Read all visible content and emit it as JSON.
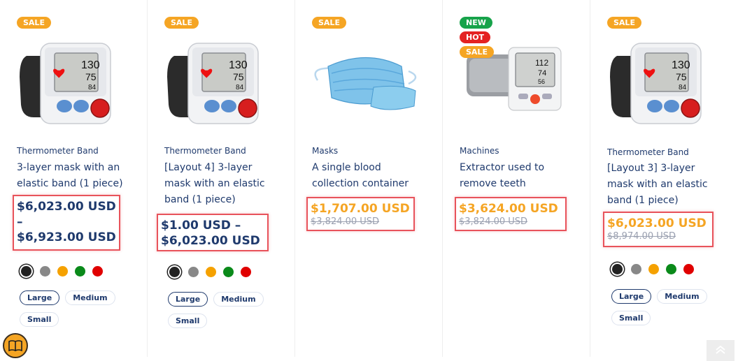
{
  "products": [
    {
      "badges": [
        "SALE"
      ],
      "category": "Thermometer Band",
      "title": "3-layer mask with an elastic band (1 piece)",
      "price_lines": [
        "$6,023.00 USD",
        "–",
        "$6,923.00 USD"
      ],
      "sizes": [
        "Large",
        "Medium",
        "Small"
      ],
      "image": "blood-pressure-monitor"
    },
    {
      "badges": [
        "SALE"
      ],
      "category": "Thermometer Band",
      "title": "[Layout 4] 3-layer mask with an elastic band (1 piece)",
      "price_lines": [
        "$1.00 USD –",
        "$6,023.00 USD"
      ],
      "sizes": [
        "Large",
        "Medium",
        "Small"
      ],
      "image": "blood-pressure-monitor"
    },
    {
      "badges": [
        "SALE"
      ],
      "category": "Masks",
      "title": "A single blood collection container",
      "price": "$1,707.00 USD",
      "old_price": "$3,824.00 USD",
      "image": "surgical-mask"
    },
    {
      "badges": [
        "NEW",
        "HOT",
        "SALE"
      ],
      "category": "Machines",
      "title": "Extractor used to remove teeth",
      "price": "$3,624.00 USD",
      "old_price": "$3,824.00 USD",
      "image": "digital-bp-machine"
    },
    {
      "badges": [
        "SALE"
      ],
      "category": "Thermometer Band",
      "title": "[Layout 3] 3-layer mask with an elastic band (1 piece)",
      "price": "$6,023.00 USD",
      "old_price": "$8,974.00 USD",
      "sizes": [
        "Large",
        "Medium",
        "Small"
      ],
      "image": "blood-pressure-monitor"
    }
  ],
  "swatch_colors": [
    "#222222",
    "#888888",
    "#f5a100",
    "#0a8a1a",
    "#e00000"
  ],
  "colors": {
    "sale_badge": "#f5a524",
    "new_badge": "#17a34a",
    "hot_badge": "#e42222",
    "text": "#1f3a6d",
    "highlight_border": "#e8535b"
  },
  "icons": [
    "book-icon",
    "chevron-up-icon"
  ]
}
